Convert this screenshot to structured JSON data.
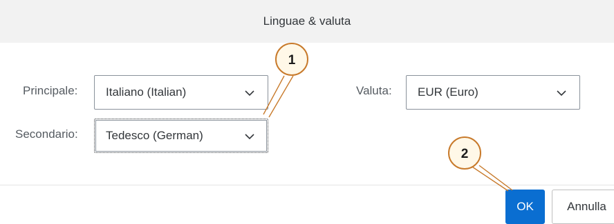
{
  "dialog": {
    "title": "Linguae & valuta"
  },
  "form": {
    "primary": {
      "label": "Principale:",
      "value": "Italiano (Italian)"
    },
    "secondary": {
      "label": "Secondario:",
      "value": "Tedesco (German)"
    },
    "currency": {
      "label": "Valuta:",
      "value": "EUR (Euro)"
    }
  },
  "footer": {
    "ok_label": "OK",
    "cancel_label": "Annulla"
  },
  "callouts": [
    {
      "number": "1"
    },
    {
      "number": "2"
    }
  ],
  "colors": {
    "accent": "#0a6ed1",
    "callout_ring": "#c87a2b"
  },
  "icons": {
    "dropdown": "chevron-down-icon"
  }
}
